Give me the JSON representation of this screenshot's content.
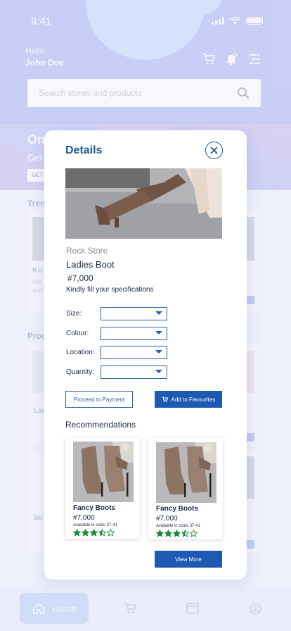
{
  "status_bar": {
    "time": "9:41"
  },
  "header": {
    "greeting": "Hello,",
    "user_name": "John Doe",
    "icons": [
      "cart-icon",
      "bell-icon",
      "menu-icon"
    ]
  },
  "search": {
    "placeholder": "Search stores and products"
  },
  "background": {
    "promo_title": "On",
    "promo_subtitle": "Get",
    "promo_button": "GET",
    "section_trending": "Tren",
    "section_products": "Prod",
    "card_texts": [
      "Ku",
      "We",
      "and",
      "Lac",
      "Su"
    ]
  },
  "modal": {
    "title": "Details",
    "store": "Rock Store",
    "product_name": "Ladies Boot",
    "price": "#7,000",
    "hint": "Kindly fill your specifications",
    "fields": [
      {
        "label": "Size:",
        "value": ""
      },
      {
        "label": "Colour:",
        "value": ""
      },
      {
        "label": "Location:",
        "value": ""
      },
      {
        "label": "Quantity:",
        "value": ""
      }
    ],
    "proceed_label": "Proceed to Payment",
    "favourites_label": "Add to Favourites",
    "recommendations_title": "Recommendations",
    "recommendations": [
      {
        "name": "Fancy Boots",
        "price": "#7,000",
        "sizes": "Available in sizes 37-41",
        "rating": 3.5
      },
      {
        "name": "Fancy Boots",
        "price": "#7,000",
        "sizes": "Available in sizes 37-41",
        "rating": 3.5
      }
    ],
    "view_more_label": "View More"
  },
  "bottom_nav": {
    "active_label": "Home",
    "items": [
      "home-icon",
      "cart-icon",
      "store-icon",
      "profile-icon"
    ]
  },
  "colors": {
    "accent": "#1e5ab4",
    "title": "#1e5a96",
    "star": "#1b8a3a",
    "header_bg": "#aab3ef"
  }
}
